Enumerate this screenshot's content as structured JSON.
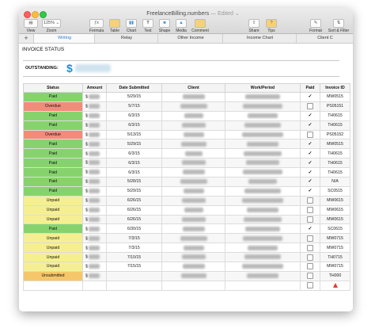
{
  "window": {
    "title": "FreelanceBilling.numbers",
    "title_suffix": " — Edited ⌄"
  },
  "toolbar": {
    "view_label": "View",
    "zoom_value": "125% ⌄",
    "zoom_label": "Zoom",
    "formula_label": "Formula",
    "table_label": "Table",
    "chart_label": "Chart",
    "text_label": "Text",
    "shape_label": "Shape",
    "media_label": "Media",
    "comment_label": "Comment",
    "share_label": "Share",
    "tips_label": "Tips",
    "format_label": "Format",
    "sortfilter_label": "Sort & Filter"
  },
  "tabs": [
    "Writing",
    "Relay",
    "Other Income",
    "Income Chart",
    "Client C"
  ],
  "active_tab": "Writing",
  "sheet": {
    "title": "INVOICE STATUS",
    "outstanding_label": "OUTSTANDING:",
    "outstanding_symbol": "$"
  },
  "table": {
    "headers": [
      "Status",
      "Amount",
      "Date Submitted",
      "Client",
      "Work/Period",
      "Paid",
      "Invoice ID"
    ],
    "rows": [
      {
        "status": "Paid",
        "amount": "$",
        "date": "5/29/15",
        "paid": true,
        "invoice": "MW0515"
      },
      {
        "status": "Overdue",
        "amount": "$",
        "date": "5/7/15",
        "paid": false,
        "invoice": "PS05151"
      },
      {
        "status": "Paid",
        "amount": "$",
        "date": "6/3/15",
        "paid": true,
        "invoice": "TH0615"
      },
      {
        "status": "Paid",
        "amount": "$",
        "date": "6/3/15",
        "paid": true,
        "invoice": "TH0615"
      },
      {
        "status": "Overdue",
        "amount": "$",
        "date": "5/13/15",
        "paid": false,
        "invoice": "PS05152"
      },
      {
        "status": "Paid",
        "amount": "$",
        "date": "5/29/15",
        "paid": true,
        "invoice": "MW0515"
      },
      {
        "status": "Paid",
        "amount": "$",
        "date": "6/3/15",
        "paid": true,
        "invoice": "TH0615"
      },
      {
        "status": "Paid",
        "amount": "$",
        "date": "6/3/15",
        "paid": true,
        "invoice": "TH0615"
      },
      {
        "status": "Paid",
        "amount": "$",
        "date": "6/3/15",
        "paid": true,
        "invoice": "TH0615"
      },
      {
        "status": "Paid",
        "amount": "$",
        "date": "5/28/15",
        "paid": true,
        "invoice": "N/A"
      },
      {
        "status": "Paid",
        "amount": "$",
        "date": "5/29/15",
        "paid": true,
        "invoice": "SC0515"
      },
      {
        "status": "Unpaid",
        "amount": "$",
        "date": "6/26/15",
        "paid": false,
        "invoice": "MW0615"
      },
      {
        "status": "Unpaid",
        "amount": "$",
        "date": "6/26/15",
        "paid": false,
        "invoice": "MW0615"
      },
      {
        "status": "Unpaid",
        "amount": "$",
        "date": "6/26/15",
        "paid": false,
        "invoice": "MW0615"
      },
      {
        "status": "Paid",
        "amount": "$",
        "date": "6/30/15",
        "paid": true,
        "invoice": "SC0615"
      },
      {
        "status": "Unpaid",
        "amount": "$",
        "date": "7/3/15",
        "paid": false,
        "invoice": "MW0715"
      },
      {
        "status": "Unpaid",
        "amount": "$",
        "date": "7/3/15",
        "paid": false,
        "invoice": "MW0715"
      },
      {
        "status": "Unpaid",
        "amount": "$",
        "date": "7/10/15",
        "paid": false,
        "invoice": "TH0715"
      },
      {
        "status": "Unpaid",
        "amount": "$",
        "date": "7/15/15",
        "paid": false,
        "invoice": "MW0715"
      },
      {
        "status": "Unsubmitted",
        "amount": "$",
        "date": "",
        "paid": false,
        "invoice": "TH000"
      },
      {
        "status": "",
        "amount": "",
        "date": "",
        "paid": false,
        "invoice": "",
        "warning": true
      }
    ]
  },
  "status_colors": {
    "Paid": "#86d36d",
    "Overdue": "#f28b7a",
    "Unpaid": "#f6ef92",
    "Unsubmitted": "#f5c76a"
  }
}
